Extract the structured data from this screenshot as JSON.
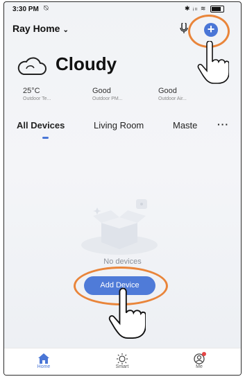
{
  "status_bar": {
    "time": "3:30 PM",
    "silent_icon": "silent-icon",
    "icons": "✱ ᵢₗₗ ≋"
  },
  "header": {
    "home_name": "Ray Home",
    "add_icon": "plus-icon",
    "mic_icon": "mic-icon"
  },
  "weather": {
    "condition": "Cloudy",
    "icon": "cloud-icon",
    "stats": [
      {
        "value": "25°C",
        "label": "Outdoor Te..."
      },
      {
        "value": "Good",
        "label": "Outdoor PM..."
      },
      {
        "value": "Good",
        "label": "Outdoor Air..."
      }
    ]
  },
  "tabs": {
    "items": [
      "All Devices",
      "Living Room",
      "Maste"
    ],
    "active": "All Devices",
    "more": "···"
  },
  "empty_state": {
    "text": "No devices",
    "add_button": "Add Device"
  },
  "bottom_nav": {
    "items": [
      {
        "label": "Home",
        "icon": "home-icon"
      },
      {
        "label": "Smart",
        "icon": "sun-icon"
      },
      {
        "label": "Me",
        "icon": "profile-icon"
      }
    ],
    "active": "Home"
  },
  "colors": {
    "accent": "#4a76d6",
    "annotation": "#e9853a"
  }
}
